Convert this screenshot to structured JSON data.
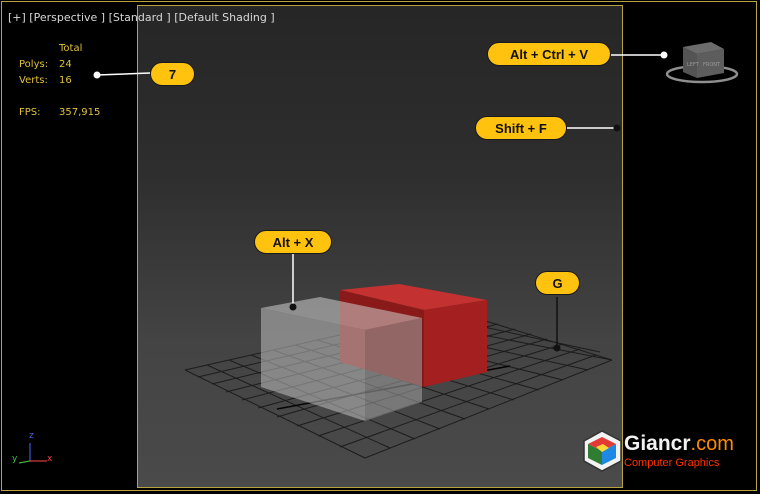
{
  "viewport": {
    "menu_labels": "[+] [Perspective ] [Standard ] [Default Shading ]"
  },
  "stats": {
    "total_header": "Total",
    "polys_label": "Polys:",
    "polys_value": "24",
    "verts_label": "Verts:",
    "verts_value": "16",
    "fps_label": "FPS:",
    "fps_value": "357,915"
  },
  "callouts": {
    "seven": "7",
    "alt_ctrl_v": "Alt + Ctrl + V",
    "shift_f": "Shift + F",
    "alt_x": "Alt + X",
    "g": "G"
  },
  "axis_tripod": {
    "z": "z",
    "y": "y",
    "x": "x"
  },
  "branding": {
    "name_main": "Giancr",
    "name_suffix": ".com",
    "tagline": "Computer Graphics"
  },
  "colors": {
    "callout": "#ffc20e",
    "frame": "#b8a33c",
    "stats_text": "#e0c23a",
    "red_box": "#b22222",
    "brand_orange": "#ff8c00",
    "tagline": "#ff3300"
  },
  "icons": {
    "viewcube": "viewcube-icon",
    "logo": "giancr-logo-icon"
  }
}
